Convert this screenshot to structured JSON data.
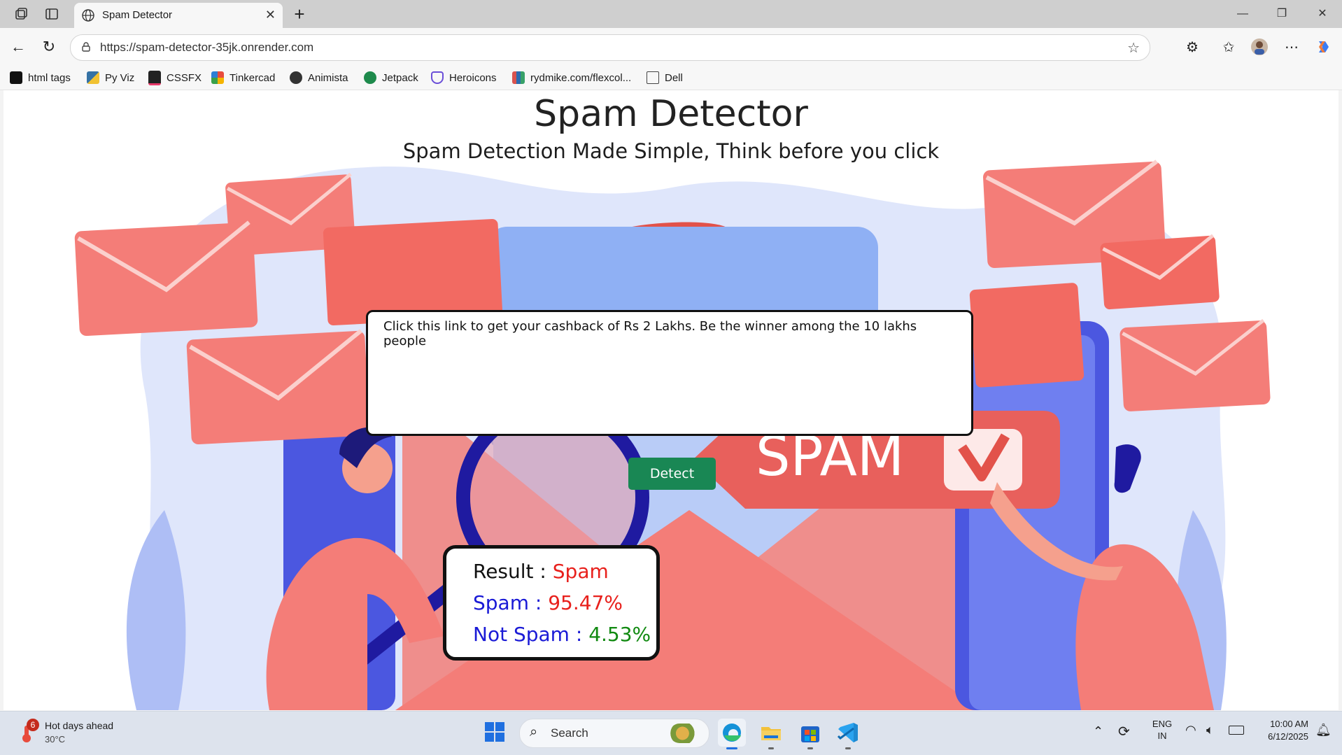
{
  "browser": {
    "tab_title": "Spam Detector",
    "url": "https://spam-detector-35jk.onrender.com",
    "bookmarks": [
      {
        "label": "html tags",
        "icon": "html-tags-icon",
        "color": "#111111"
      },
      {
        "label": "Py Viz",
        "icon": "python-icon",
        "color": "#3572A5"
      },
      {
        "label": "CSSFX",
        "icon": "cssfx-icon",
        "color": "#222222"
      },
      {
        "label": "Tinkercad",
        "icon": "tinkercad-icon",
        "color": "#e84b3c"
      },
      {
        "label": "Animista",
        "icon": "animista-icon",
        "color": "#333333"
      },
      {
        "label": "Jetpack",
        "icon": "jetpack-icon",
        "color": "#1e8a4c"
      },
      {
        "label": "Heroicons",
        "icon": "heroicons-icon",
        "color": "#6b4fd8"
      },
      {
        "label": "rydmike.com/flexcol...",
        "icon": "flexcolor-icon",
        "color": "#d9534f"
      },
      {
        "label": "Dell",
        "icon": "folder-icon",
        "color": "#555555"
      }
    ]
  },
  "page": {
    "title": "Spam Detector",
    "subtitle": "Spam Detection Made Simple, Think before you click",
    "message": "Click this link to get your cashback of Rs 2 Lakhs. Be the winner among the 10 lakhs people",
    "detect_label": "Detect",
    "spam_badge": "SPAM",
    "result": {
      "result_label": "Result :",
      "result_value": "Spam",
      "spam_label": "Spam :",
      "spam_value": "95.47%",
      "not_spam_label": "Not Spam :",
      "not_spam_value": "4.53%"
    },
    "colors": {
      "accent_button": "#198754",
      "spam_red": "#e8201c",
      "label_blue": "#1a1ad6",
      "safe_green": "#118a11"
    }
  },
  "taskbar": {
    "weather_badge": "6",
    "weather_title": "Hot days ahead",
    "weather_temp": "30°C",
    "search_placeholder": "Search",
    "lang_top": "ENG",
    "lang_bottom": "IN",
    "time": "10:00 AM",
    "date": "6/12/2025"
  }
}
